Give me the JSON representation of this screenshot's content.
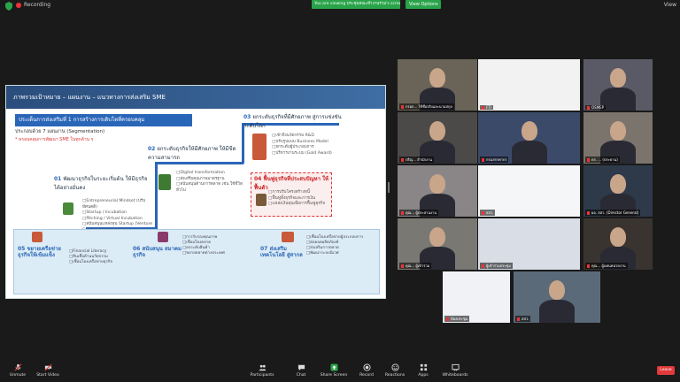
{
  "topbar": {
    "recording_label": "Recording",
    "share_banner": "You are viewing ประชุมคณะทำงานร่วม's screen",
    "view_options": "View Options",
    "view_label": "View"
  },
  "slide": {
    "title": "ภาพรวมเป้าหมาย – แผนงาน – แนวทางการส่งเสริม SME",
    "pillar": "ประเด็นการส่งเสริมที่ 1 การสร้างการเติบโตที่ครอบคลุม",
    "target": "ประกอบด้วย 7 แผนงาน (Segmentation)",
    "target_note": "* ครอบคลุมการพัฒนา SME ในทุกด้าน ๆ",
    "step01_num": "01",
    "step01": "พัฒนาธุรกิจในระยะเริ่มต้น ให้มีธุรกิจได้อย่างมั่นคง",
    "step01_items": [
      "Entrepreneurial Mindset (ปรับทัศนคติ)",
      "Startup / Incubation",
      "Pitching / Virtual Incubation",
      "สนับสนุนแหล่งทุน Startup (Venture Capital, Angel Investor)"
    ],
    "step02_num": "02",
    "step02": "ยกระดับธุรกิจให้มีศักยภาพ ให้มีขีดความสามารถ",
    "step02_items": [
      "Digital transformation",
      "ส่งเสริมคุณภาพมาตรฐาน",
      "สนับสนุนด้านการตลาด เช่น ใช้ชีวิตทั่วไป"
    ],
    "step03_num": "03",
    "step03": "ยกระดับธุรกิจที่มีศักยภาพ สู่การแข่งขันระดับโลก",
    "step03_items": [
      "เข้าถึงนวัตกรรม R&D",
      "ปรับรูปแบบ Business Model",
      "ยกระดับผู้ประกอบการ",
      "บริหารงานระบบ (Gold Award)"
    ],
    "step04_num": "04",
    "step04": "ฟื้นฟูธุรกิจที่ประสบปัญหา ให้ฟื้นตัว",
    "step04_items": [
      "การปรับโครงสร้างหนี้",
      "ฟื้นฟูทั้งธุรกิจและการเงิน",
      "แหล่งเงินทุนเพื่อการฟื้นฟูธุรกิจ"
    ],
    "step05_num": "05",
    "step05": "ขยายเครือข่าย ธุรกิจให้เข้มแข็ง",
    "step05_items": [
      "Financial Literacy",
      "สินเชื่อด้านนวัตกรรม",
      "เชื่อมโยงเครือข่ายธุรกิจ"
    ],
    "step06_num": "06",
    "step06": "สนับสนุน สมาคมธุรกิจ",
    "step06_items": [
      "การรับรองคุณภาพ",
      "เชื่อมโยงตลาด",
      "ยกระดับสินค้า",
      "ขยายตลาดต่างประเทศ"
    ],
    "step07_num": "07",
    "step07": "ส่งเสริม เทคโนโลยี สู่สากล",
    "step07_items": [
      "เชื่อมโยงเครือข่ายผู้ประกอบการ",
      "ต่อยอดผลิตภัณฑ์",
      "ส่งเสริมการตลาด",
      "พัฒนาระบบนิเวศ"
    ]
  },
  "participants": [
    {
      "name": "กรอก... ใช้ชื่อจริงและนามสกุล"
    },
    {
      "name": "FTI"
    },
    {
      "name": "OSMEP"
    },
    {
      "name": "ปริญ... สำนักงาน"
    },
    {
      "name": "กรมสรรพากร"
    },
    {
      "name": "ดร. ... (ประธาน)"
    },
    {
      "name": "คุณ... ผู้ประสานงาน"
    },
    {
      "name": "สสว."
    },
    {
      "name": "ผอ. สสว. (Director General)"
    },
    {
      "name": "คุณ... ผู้เข้าร่วม"
    },
    {
      "name": "ผู้เข้าร่วมประชุม"
    },
    {
      "name": "คุณ... ผู้แทนหน่วยงาน"
    },
    {
      "name": "ห้องประชุม"
    },
    {
      "name": "สสว."
    },
    {
      "name": "ผู้เข้าร่วม"
    },
    {
      "name": "ผู้แทน 209-63"
    }
  ],
  "toolbar": {
    "unmute": "Unmute",
    "start_video": "Start Video",
    "participants": "Participants",
    "participants_count": "17",
    "chat": "Chat",
    "share_screen": "Share Screen",
    "record": "Record",
    "reactions": "Reactions",
    "apps": "Apps",
    "whiteboards": "Whiteboards",
    "leave": "Leave"
  },
  "colors": {
    "accent_green": "#2aa44a",
    "leave_red": "#e03a3a",
    "slide_blue": "#2a66b8"
  }
}
